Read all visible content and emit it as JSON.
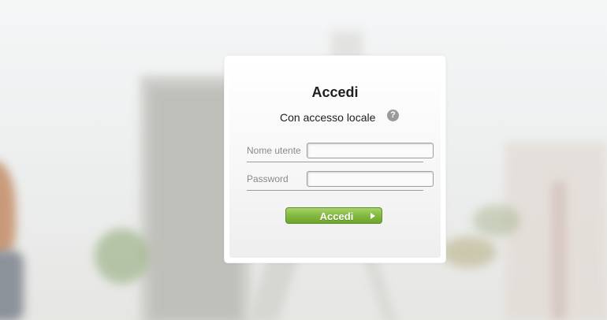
{
  "login": {
    "title": "Accedi",
    "subtitle": "Con accesso locale",
    "help_icon": "question-mark-icon",
    "help_glyph": "?",
    "username_label": "Nome utente",
    "username_value": "",
    "password_label": "Password",
    "password_value": "",
    "submit_label": "Accedi",
    "submit_icon": "play-arrow-icon"
  },
  "colors": {
    "button_green": "#86bb43",
    "panel_bg": "#ffffff",
    "text": "#1e1e1e",
    "label_gray": "#8a8a8a"
  }
}
